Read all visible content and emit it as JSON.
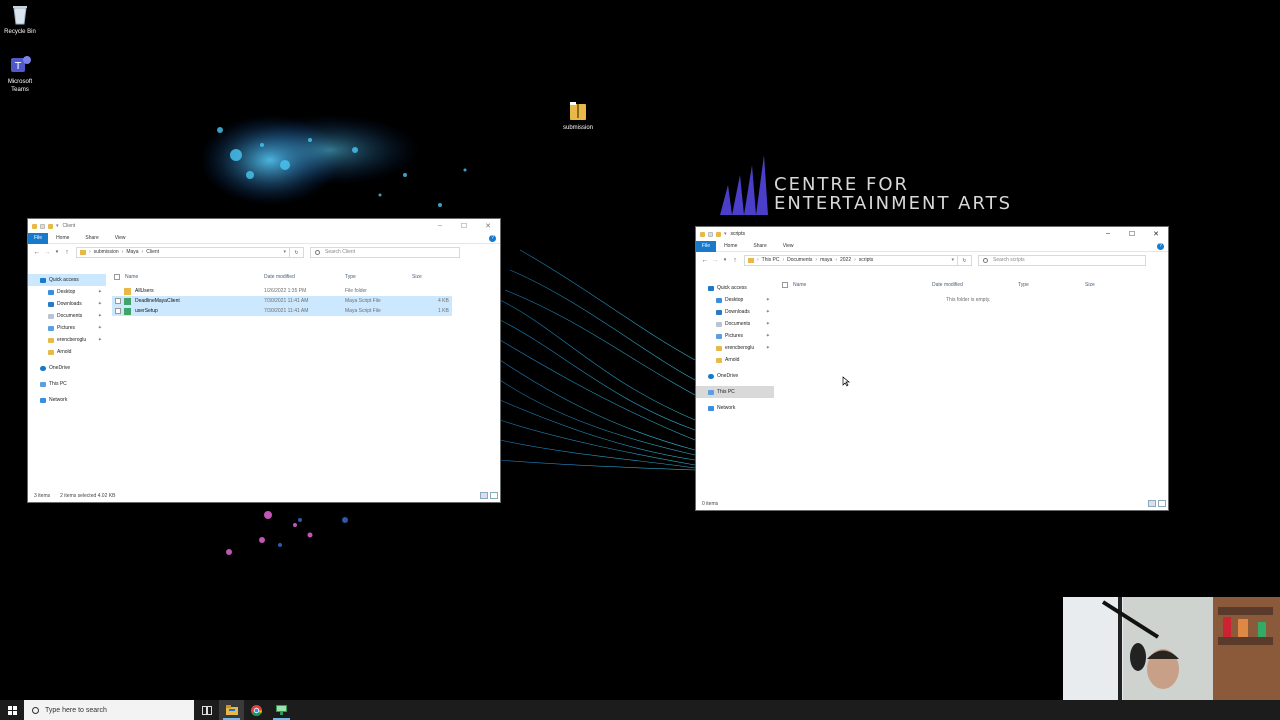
{
  "desktop": {
    "icons": [
      {
        "label": "Recycle Bin",
        "icon": "recycle-bin-icon"
      },
      {
        "label": "Microsoft Teams",
        "icon": "teams-icon"
      },
      {
        "label": "submission",
        "icon": "zip-folder-icon"
      }
    ],
    "wallpaper": {
      "brand_line1": "CENTRE FOR",
      "brand_line2": "ENTERTAINMENT ARTS"
    }
  },
  "window_client": {
    "title": "Client",
    "ribbon_tabs": [
      "File",
      "Home",
      "Share",
      "View"
    ],
    "path": [
      "submission",
      "Maya",
      "Client"
    ],
    "search_placeholder": "Search Client",
    "columns": [
      "Name",
      "Date modified",
      "Type",
      "Size"
    ],
    "nav": [
      {
        "label": "Quick access",
        "icon": "star-icon"
      },
      {
        "label": "Desktop",
        "icon": "desktop-icon"
      },
      {
        "label": "Downloads",
        "icon": "download-icon"
      },
      {
        "label": "Documents",
        "icon": "documents-icon"
      },
      {
        "label": "Pictures",
        "icon": "pictures-icon"
      },
      {
        "label": "erencberoglu",
        "icon": "folder-icon"
      },
      {
        "label": "Arnold",
        "icon": "folder-icon"
      },
      {
        "label": "OneDrive",
        "icon": "cloud-icon"
      },
      {
        "label": "This PC",
        "icon": "computer-icon"
      },
      {
        "label": "Network",
        "icon": "network-icon"
      }
    ],
    "files": [
      {
        "name": "AllUsers",
        "date": "1/26/2022 1:35 PM",
        "type": "File folder",
        "size": "",
        "selected": false
      },
      {
        "name": "DeadlineMayaClient",
        "date": "7/30/2021 11:41 AM",
        "type": "Maya Script File",
        "size": "4 KB",
        "selected": true
      },
      {
        "name": "userSetup",
        "date": "7/30/2021 11:41 AM",
        "type": "Maya Script File",
        "size": "1 KB",
        "selected": true
      }
    ],
    "status_items": "3 items",
    "status_selected": "2 items selected  4.02 KB"
  },
  "window_scripts": {
    "title": "scripts",
    "ribbon_tabs": [
      "File",
      "Home",
      "Share",
      "View"
    ],
    "path": [
      "This PC",
      "Documents",
      "maya",
      "2022",
      "scripts"
    ],
    "search_placeholder": "Search scripts",
    "columns": [
      "Name",
      "Date modified",
      "Type",
      "Size"
    ],
    "nav": [
      {
        "label": "Quick access",
        "icon": "star-icon"
      },
      {
        "label": "Desktop",
        "icon": "desktop-icon"
      },
      {
        "label": "Downloads",
        "icon": "download-icon"
      },
      {
        "label": "Documents",
        "icon": "documents-icon"
      },
      {
        "label": "Pictures",
        "icon": "pictures-icon"
      },
      {
        "label": "erencberoglu",
        "icon": "folder-icon"
      },
      {
        "label": "Arnold",
        "icon": "folder-icon"
      },
      {
        "label": "OneDrive",
        "icon": "cloud-icon"
      },
      {
        "label": "This PC",
        "icon": "computer-icon"
      },
      {
        "label": "Network",
        "icon": "network-icon"
      }
    ],
    "empty_text": "This folder is empty.",
    "status_items": "0 items"
  },
  "taskbar": {
    "search_placeholder": "Type here to search",
    "apps": [
      "task-view-icon",
      "file-explorer-icon",
      "chrome-icon",
      "remote-desktop-icon"
    ]
  },
  "colors": {
    "accent": "#1979ca",
    "selection": "#cce8ff",
    "taskbar": "#1c1c1c"
  }
}
